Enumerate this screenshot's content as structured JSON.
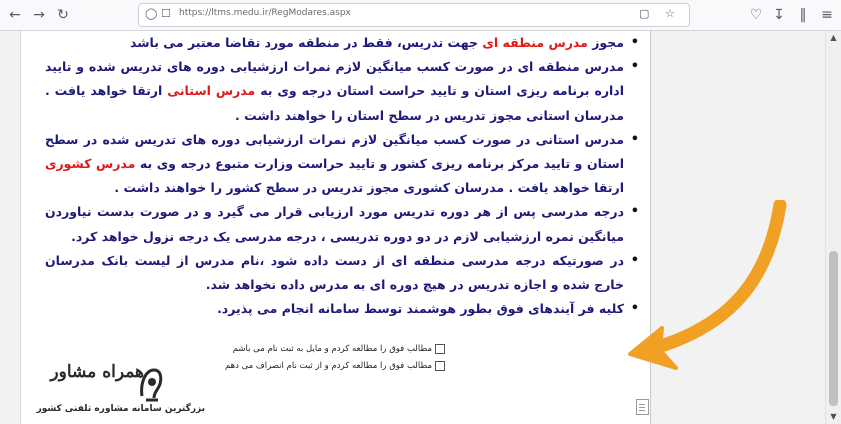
{
  "browser": {
    "url": "https://ltms.medu.ir/RegModares.aspx",
    "back_icon": "arrow-left-icon",
    "forward_icon": "arrow-right-icon",
    "reload_icon": "reload-icon"
  },
  "rules": [
    {
      "parts": [
        {
          "text": "مجوز "
        },
        {
          "text": "مدرس منطقه ای",
          "hl": true
        },
        {
          "text": " جهت تدریس، فقط در منطقه مورد تقاضا معتبر می باشد"
        }
      ]
    },
    {
      "parts": [
        {
          "text": "مدرس منطقه ای در صورت کسب میانگین لازم نمرات ارزشیابی دوره های تدریس شده و تایید اداره برنامه ریزی استان و تایید حراست استان درجه وی به "
        },
        {
          "text": "مدرس استانی",
          "hl": true
        },
        {
          "text": " ارتقا خواهد یافت . مدرسان استانی مجوز تدریس در سطح استان را خواهند داشت ."
        }
      ]
    },
    {
      "parts": [
        {
          "text": "مدرس استانی در صورت کسب میانگین لازم نمرات ارزشیابی دوره های تدریس شده در سطح استان و تایید مرکز برنامه ریزی کشور  و  تایید حراست وزارت متبوع درجه وی به "
        },
        {
          "text": "مدرس کشوری",
          "hl": true
        },
        {
          "text": " ارتقا خواهد یافت . مدرسان کشوری مجوز تدریس در سطح کشور را خواهند داشت ."
        }
      ]
    },
    {
      "parts": [
        {
          "text": "درجه مدرسی پس از هر دوره تدریس مورد ارزیابی قرار می گیرد و در صورت بدست نیاوردن میانگین نمره ارزشیابی لازم  در  دو دوره تدریسی ، درجه مدرسی یک درجه نزول خواهد کرد."
        }
      ]
    },
    {
      "parts": [
        {
          "text": "در صورتیکه درجه مدرسی منطقه ای از دست داده شود ،نام مدرس از لیست بانک مدرسان خارج شده و اجازه تدریس در هیچ دوره ای به مدرس داده نخواهد شد."
        }
      ]
    },
    {
      "parts": [
        {
          "text": "کلیه فر آیندهای فوق بطور هوشمند توسط سامانه انجام می پذیرد."
        }
      ]
    }
  ],
  "checks": {
    "accept_label": "مطالب فوق را مطالعه کردم و مایل به ثبت نام می باشم",
    "decline_label": "مطالب فوق را مطالعه کردم و از ثبت نام انصراف می دهم"
  },
  "logo": {
    "title": "همراه مشاور",
    "subtitle": "بزرگترین سامانه مشاوره تلفنی کشور"
  },
  "colors": {
    "text": "#1f1a7a",
    "highlight": "#e01818",
    "arrow": "#f0a023"
  }
}
